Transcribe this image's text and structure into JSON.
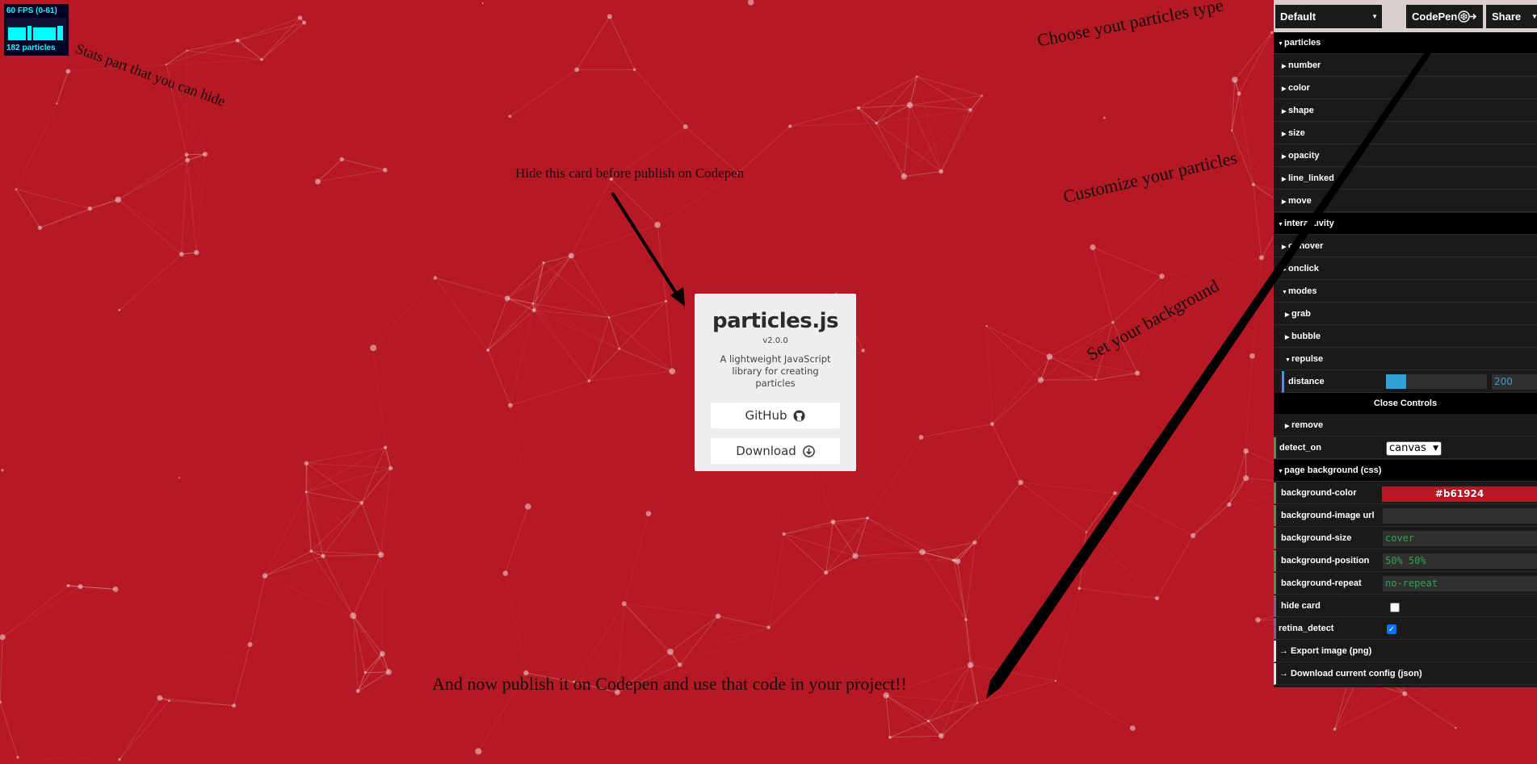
{
  "colors": {
    "background": "#b61924",
    "panel": "#1a1a1a",
    "accent_blue": "#2fa1d6",
    "accent_green": "#2fa14f"
  },
  "stats": {
    "fps": "60 FPS (0-61)",
    "particles": "182 particles"
  },
  "annotations": {
    "stats_hint": "Stats part that you can hide",
    "type_hint": "Choose yout particles type",
    "card_hint": "Hide this card before publish on Codepen",
    "customize_hint": "Customize your particles",
    "background_hint": "Set your background",
    "publish_hint": "And now publish it on Codepen and use that code in your project!!"
  },
  "card": {
    "title": "particles.js",
    "version": "v2.0.0",
    "description": "A lightweight JavaScript library for creating particles",
    "github_label": "GitHub",
    "download_label": "Download"
  },
  "toolbar": {
    "preset": "Default",
    "codepen_label": "CodePen",
    "share_label": "Share"
  },
  "controls": {
    "particles": "particles",
    "number": "number",
    "color": "color",
    "shape": "shape",
    "size": "size",
    "opacity": "opacity",
    "line_linked": "line_linked",
    "move": "move",
    "interactivity": "interactivity",
    "onhover": "onhover",
    "onclick": "onclick",
    "modes": "modes",
    "grab": "grab",
    "bubble": "bubble",
    "repulse": "repulse",
    "distance_label": "distance",
    "distance_value": "200",
    "distance_fraction": 0.2,
    "close_controls": "Close Controls",
    "remove": "remove",
    "detect_on_label": "detect_on",
    "detect_on_value": "canvas",
    "page_background": "page background (css)",
    "bg_color_label": "background-color",
    "bg_color_value": "#b61924",
    "bg_image_label": "background-image url",
    "bg_image_value": "",
    "bg_size_label": "background-size",
    "bg_size_value": "cover",
    "bg_position_label": "background-position",
    "bg_position_value": "50% 50%",
    "bg_repeat_label": "background-repeat",
    "bg_repeat_value": "no-repeat",
    "hide_card_label": "hide card",
    "hide_card_checked": false,
    "retina_label": "retina_detect",
    "retina_checked": true,
    "export_image": "→ Export image (png)",
    "download_config": "→ Download current config (json)"
  }
}
